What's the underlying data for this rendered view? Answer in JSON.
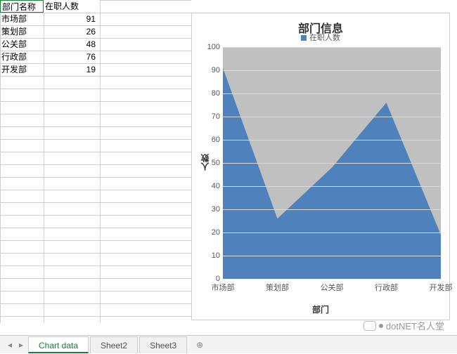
{
  "table": {
    "headers": [
      "部门名称",
      "在职人数"
    ],
    "rows": [
      {
        "name": "市场部",
        "count": 91
      },
      {
        "name": "策划部",
        "count": 26
      },
      {
        "name": "公关部",
        "count": 48
      },
      {
        "name": "行政部",
        "count": 76
      },
      {
        "name": "开发部",
        "count": 19
      }
    ]
  },
  "chart_data": {
    "type": "area",
    "title": "部门信息",
    "legend": "在职人数",
    "xlabel": "部门",
    "ylabel": "人数",
    "categories": [
      "市场部",
      "策划部",
      "公关部",
      "行政部",
      "开发部"
    ],
    "values": [
      91,
      26,
      48,
      76,
      19
    ],
    "ylim": [
      0,
      100
    ],
    "yticks": [
      0,
      10,
      20,
      30,
      40,
      50,
      60,
      70,
      80,
      90,
      100
    ]
  },
  "tabs": {
    "items": [
      "Chart data",
      "Sheet2",
      "Sheet3"
    ],
    "active": 0,
    "add_icon": "⊕",
    "nav_prev": "◂",
    "nav_next": "▸"
  },
  "watermark": "dotNET名人堂"
}
